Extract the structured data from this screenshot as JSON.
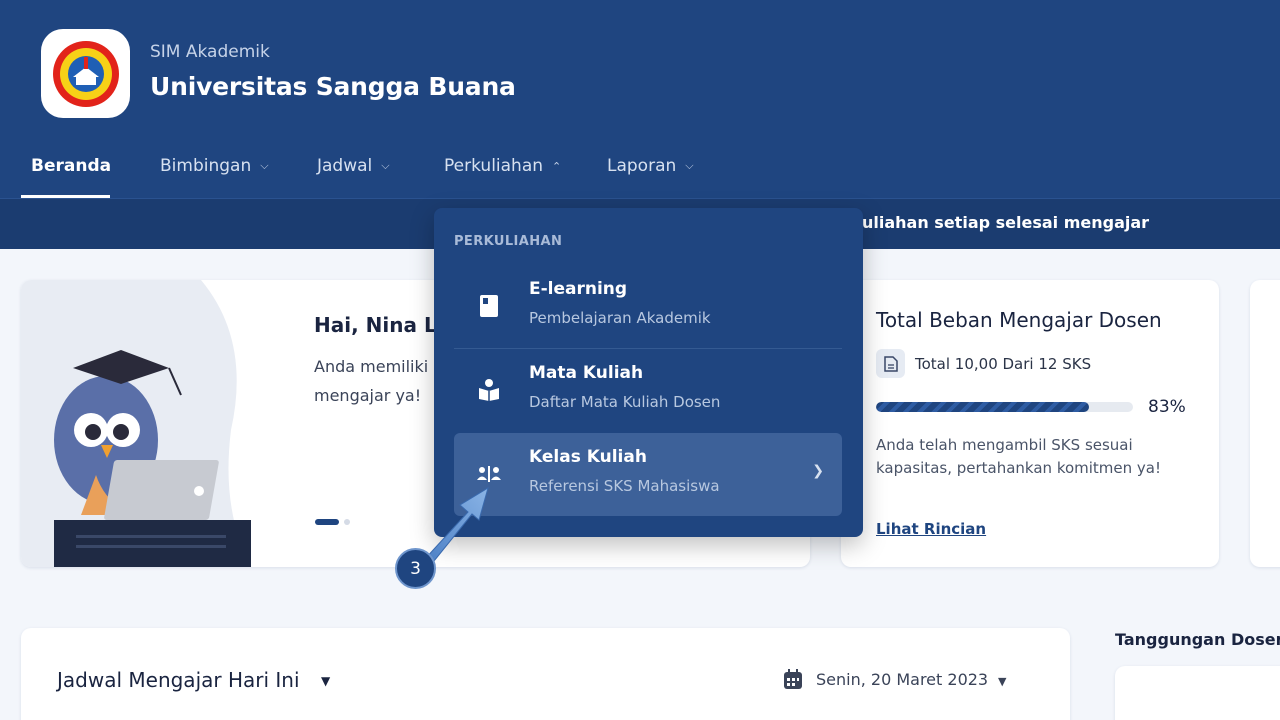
{
  "header": {
    "subtitle": "SIM Akademik",
    "title": "Universitas Sangga Buana",
    "logo_ring_text": "UNIVERSITAS",
    "logo_bottom_text": "SANGGA BUANA",
    "logo_ypkp": "YPKP"
  },
  "nav": {
    "items": [
      {
        "label": "Beranda"
      },
      {
        "label": "Bimbingan"
      },
      {
        "label": "Jadwal"
      },
      {
        "label": "Perkuliahan"
      },
      {
        "label": "Laporan"
      }
    ]
  },
  "ticker": {
    "text": "uliahan setiap selesai mengajar"
  },
  "welcome": {
    "greeting": "Hai, Nina Les",
    "text": "Anda memiliki mengajar ya!"
  },
  "load": {
    "title": "Total Beban Mengajar Dosen",
    "total": "Total 10,00 Dari 12 SKS",
    "percent_label": "83%",
    "percent": 0.83,
    "note": "Anda telah mengambil SKS sesuai kapasitas, pertahankan komitmen ya!",
    "link": "Lihat Rincian"
  },
  "schedule": {
    "title": "Jadwal Mengajar Hari Ini",
    "date": "Senin, 20 Maret 2023"
  },
  "side": {
    "title": "Tanggungan Dosen"
  },
  "dropdown": {
    "heading": "PERKULIAHAN",
    "items": [
      {
        "label": "E-learning",
        "desc": "Pembelajaran Akademik",
        "icon": "book-icon"
      },
      {
        "label": "Mata Kuliah",
        "desc": "Daftar Mata Kuliah Dosen",
        "icon": "reader-icon"
      },
      {
        "label": "Kelas Kuliah",
        "desc": "Referensi SKS Mahasiswa",
        "icon": "class-icon"
      }
    ]
  },
  "annotation": {
    "step": "3"
  },
  "colors": {
    "brand": "#1f4580",
    "highlight": "#3d6199",
    "background": "#f3f6fb"
  }
}
